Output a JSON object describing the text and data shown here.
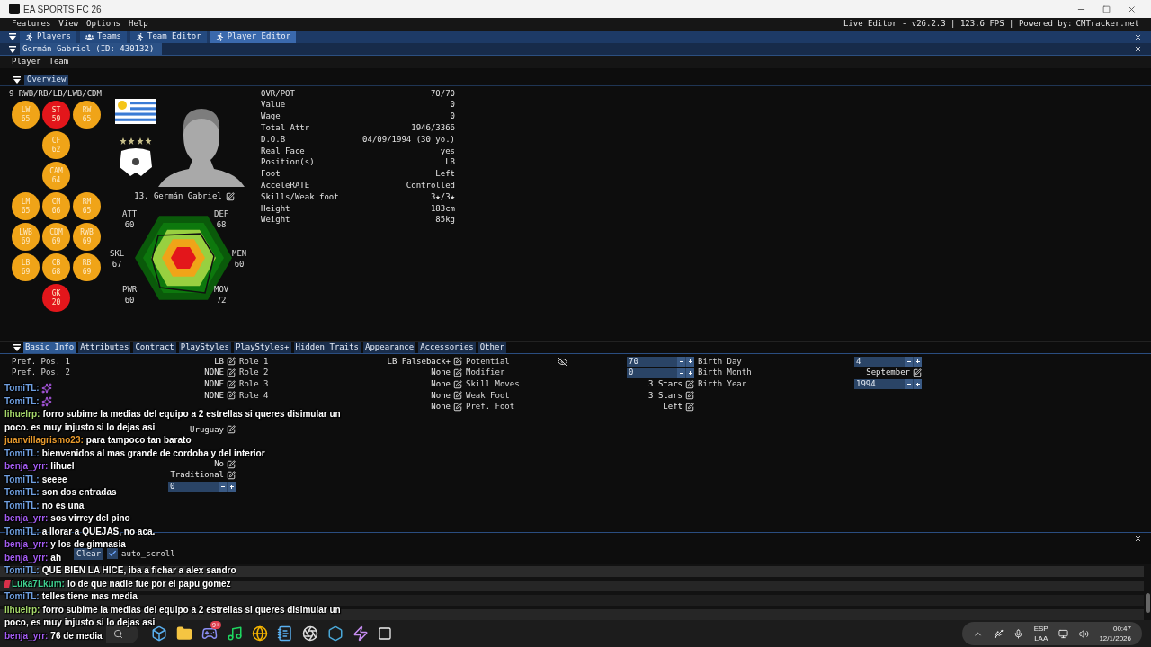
{
  "window": {
    "title": "EA SPORTS FC 26"
  },
  "menu": [
    "Features",
    "View",
    "Options",
    "Help"
  ],
  "status_text": "Live Editor - v26.2.3 | 123.6 FPS | Powered by:",
  "status_link": "CMTracker.net",
  "tabs": [
    {
      "label": "Players",
      "kind": "runner",
      "selected": false
    },
    {
      "label": "Teams",
      "kind": "group",
      "selected": false
    },
    {
      "label": "Team Editor",
      "kind": "runner",
      "selected": false
    },
    {
      "label": "Player Editor",
      "kind": "runner",
      "selected": true
    }
  ],
  "player_header": "Germán Gabriel (ID: 430132)",
  "submenu": [
    "Player",
    "Team"
  ],
  "section": "Overview",
  "positions": {
    "heading": "9 RWB/RB/LB/LWB/CDM",
    "rows": [
      {
        "left": {
          "pos": "LW",
          "rating": "65",
          "color": "#f0a418"
        },
        "center": {
          "pos": "ST",
          "rating": "59",
          "color": "#e3161b"
        },
        "right": {
          "pos": "RW",
          "rating": "65",
          "color": "#f0a418"
        }
      },
      {
        "center": {
          "pos": "CF",
          "rating": "62",
          "color": "#f0a418"
        }
      },
      {
        "center": {
          "pos": "CAM",
          "rating": "64",
          "color": "#f0a418"
        }
      },
      {
        "left": {
          "pos": "LM",
          "rating": "65",
          "color": "#f0a418"
        },
        "center": {
          "pos": "CM",
          "rating": "66",
          "color": "#f0a418"
        },
        "right": {
          "pos": "RM",
          "rating": "65",
          "color": "#f0a418"
        }
      },
      {
        "left": {
          "pos": "LWB",
          "rating": "69",
          "color": "#f0a418"
        },
        "center": {
          "pos": "CDM",
          "rating": "69",
          "color": "#f0a418"
        },
        "right": {
          "pos": "RWB",
          "rating": "69",
          "color": "#f0a418"
        }
      },
      {
        "left": {
          "pos": "LB",
          "rating": "69",
          "color": "#f0a418"
        },
        "center": {
          "pos": "CB",
          "rating": "68",
          "color": "#f0a418"
        },
        "right": {
          "pos": "RB",
          "rating": "69",
          "color": "#f0a418"
        }
      },
      {
        "center": {
          "pos": "GK",
          "rating": "20",
          "color": "#e3161b"
        }
      }
    ]
  },
  "player_name": "13. Germán Gabriel",
  "radar": [
    {
      "name": "ATT",
      "value": "60"
    },
    {
      "name": "DEF",
      "value": "68"
    },
    {
      "name": "SKL",
      "value": "67"
    },
    {
      "name": "MEN",
      "value": "60"
    },
    {
      "name": "PWR",
      "value": "60"
    },
    {
      "name": "MOV",
      "value": "72"
    }
  ],
  "overview": [
    {
      "label": "OVR/POT",
      "value": "70/70"
    },
    {
      "label": "Value",
      "value": "0"
    },
    {
      "label": "Wage",
      "value": "0"
    },
    {
      "label": "Total Attr",
      "value": "1946/3366"
    },
    {
      "label": "D.O.B",
      "value": "04/09/1994 (30 yo.)"
    },
    {
      "label": "Real Face",
      "value": "yes"
    },
    {
      "label": "Position(s)",
      "value": "LB"
    },
    {
      "label": "Foot",
      "value": "Left"
    },
    {
      "label": "AcceleRATE",
      "value": "Controlled"
    },
    {
      "label": "Skills/Weak foot",
      "value": "3★/3★"
    },
    {
      "label": "Height",
      "value": "183cm"
    },
    {
      "label": "Weight",
      "value": "85kg"
    }
  ],
  "detail_tabs": [
    {
      "label": "Basic Info",
      "selected": true
    },
    {
      "label": "Attributes",
      "selected": false
    },
    {
      "label": "Contract",
      "selected": false
    },
    {
      "label": "PlayStyles",
      "selected": false
    },
    {
      "label": "PlayStyles+",
      "selected": false
    },
    {
      "label": "Hidden Traits",
      "selected": false
    },
    {
      "label": "Appearance",
      "selected": false
    },
    {
      "label": "Accessories",
      "selected": false
    },
    {
      "label": "Other",
      "selected": false
    }
  ],
  "basic_info": [
    [
      {
        "kind": "label",
        "text": "Pref. Pos. 1"
      },
      {
        "kind": "edit",
        "text": "LB"
      },
      {
        "kind": "label",
        "text": "Role 1"
      },
      {
        "kind": "edit",
        "text": "LB Falseback+"
      },
      {
        "kind": "label",
        "text": "Potential"
      },
      {
        "kind": "spin",
        "value": "70"
      },
      {
        "kind": "label",
        "text": "Birth Day"
      },
      {
        "kind": "spin",
        "value": "4"
      }
    ],
    [
      {
        "kind": "label",
        "text": "Pref. Pos. 2"
      },
      {
        "kind": "edit",
        "text": "NONE"
      },
      {
        "kind": "label",
        "text": "Role 2"
      },
      {
        "kind": "edit",
        "text": "None"
      },
      {
        "kind": "label",
        "text": "Modifier"
      },
      {
        "kind": "spin",
        "value": "0"
      },
      {
        "kind": "label",
        "text": "Birth Month"
      },
      {
        "kind": "edit",
        "text": "September"
      }
    ],
    [
      {
        "kind": "blank"
      },
      {
        "kind": "edit",
        "text": "NONE"
      },
      {
        "kind": "label",
        "text": "Role 3"
      },
      {
        "kind": "edit",
        "text": "None"
      },
      {
        "kind": "label",
        "text": "Skill Moves"
      },
      {
        "kind": "edit",
        "text": "3 Stars"
      },
      {
        "kind": "label",
        "text": "Birth Year"
      },
      {
        "kind": "spin",
        "value": "1994"
      }
    ],
    [
      {
        "kind": "blank"
      },
      {
        "kind": "edit",
        "text": "NONE"
      },
      {
        "kind": "label",
        "text": "Role 4"
      },
      {
        "kind": "edit",
        "text": "None"
      },
      {
        "kind": "label",
        "text": "Weak Foot"
      },
      {
        "kind": "edit",
        "text": "3 Stars"
      }
    ],
    [
      {
        "kind": "blank"
      },
      {
        "kind": "blank"
      },
      {
        "kind": "blank"
      },
      {
        "kind": "edit",
        "text": "None"
      },
      {
        "kind": "label",
        "text": "Pref. Foot"
      },
      {
        "kind": "edit",
        "text": "Left"
      }
    ],
    [
      {
        "kind": "blank"
      },
      {
        "kind": "blank"
      }
    ],
    [
      {
        "kind": "blank"
      },
      {
        "kind": "edit",
        "text": "Uruguay"
      }
    ],
    [
      {
        "kind": "blank"
      },
      {
        "kind": "blank"
      }
    ],
    [
      {
        "kind": "blank"
      },
      {
        "kind": "blank"
      }
    ],
    [
      {
        "kind": "blank"
      },
      {
        "kind": "edit",
        "text": "No"
      }
    ],
    [
      {
        "kind": "blank"
      },
      {
        "kind": "edit",
        "text": "Traditional"
      }
    ],
    [
      {
        "kind": "blank"
      },
      {
        "kind": "spin",
        "value": "0"
      }
    ]
  ],
  "logger": {
    "buttons": [
      "Clear"
    ],
    "auto_scroll": {
      "label": "auto_scroll",
      "checked": true
    }
  },
  "taskbar": {
    "chat_badge": "9+",
    "language": [
      "ESP",
      "LAA"
    ],
    "time": "00:47",
    "date": "12/1/2026"
  },
  "chat": [
    {
      "kind": "emote",
      "user": "TomiTL:",
      "color": "#6f9fe0"
    },
    {
      "kind": "emote",
      "user": "TomiTL:",
      "color": "#6f9fe0"
    },
    {
      "kind": "message",
      "user": "lihuelrp:",
      "color": "#a6d86a",
      "text": "forro subime la medias del equipo a 2 estrellas si queres disimular un"
    },
    {
      "kind": "continuation",
      "text": "poco. es muy injusto si lo dejas asi"
    },
    {
      "kind": "message",
      "user": "juanvillagrismo23:",
      "color": "#e89a2c",
      "text": "para tampoco tan barato"
    },
    {
      "kind": "message",
      "user": "TomiTL:",
      "color": "#6f9fe0",
      "text": "bienvenidos al mas grande de cordoba y del interior"
    },
    {
      "kind": "message",
      "user": "benja_yrr:",
      "color": "#a45cf2",
      "text": "lihuel"
    },
    {
      "kind": "message",
      "user": "TomiTL:",
      "color": "#6f9fe0",
      "text": "seeee"
    },
    {
      "kind": "message",
      "user": "TomiTL:",
      "color": "#6f9fe0",
      "text": "son dos entradas"
    },
    {
      "kind": "message",
      "user": "TomiTL:",
      "color": "#6f9fe0",
      "text": "no es una"
    },
    {
      "kind": "message",
      "user": "benja_yrr:",
      "color": "#a45cf2",
      "text": "sos virrey del pino"
    },
    {
      "kind": "message",
      "user": "TomiTL:",
      "color": "#6f9fe0",
      "text": "a llorar a QUEJAS, no aca."
    },
    {
      "kind": "message",
      "user": "benja_yrr:",
      "color": "#a45cf2",
      "text": "y los de gimnasia"
    },
    {
      "kind": "message",
      "user": "benja_yrr:",
      "color": "#a45cf2",
      "text": "ah"
    },
    {
      "kind": "message",
      "user": "TomiTL:",
      "color": "#6f9fe0",
      "text": "QUE BIEN LA HICE, iba a fichar a alex sandro"
    },
    {
      "kind": "badged",
      "user": "Luka7Lkum:",
      "color": "#3fd08f",
      "text": "lo de que nadie fue por el papu gomez"
    },
    {
      "kind": "message",
      "user": "TomiTL:",
      "color": "#6f9fe0",
      "text": "telles tiene mas media"
    },
    {
      "kind": "message",
      "user": "lihuelrp:",
      "color": "#a6d86a",
      "text": "forro subime la medias del equipo a 2 estrellas si queres disimular un"
    },
    {
      "kind": "continuation",
      "text": "poco, es muy injusto si lo dejas asi"
    },
    {
      "kind": "message",
      "user": "benja_yrr:",
      "color": "#a45cf2",
      "text": "76 de media"
    }
  ]
}
